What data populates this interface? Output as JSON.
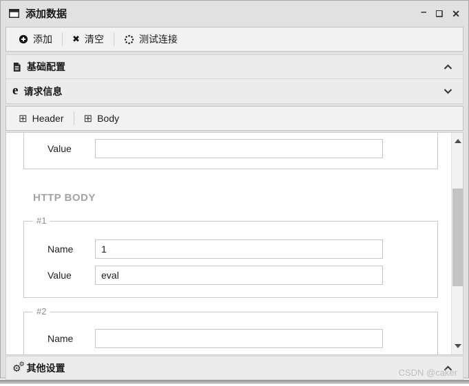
{
  "window": {
    "title": "添加数据"
  },
  "controls": {
    "minimize": "–",
    "maximize": "❑",
    "close": "✕"
  },
  "toolbar": {
    "add_label": "添加",
    "clear_label": "清空",
    "test_label": "测试连接"
  },
  "sections": {
    "basic_label": "基础配置",
    "request_label": "请求信息",
    "other_label": "其他设置"
  },
  "request_tabs": {
    "header_label": "Header",
    "body_label": "Body"
  },
  "content": {
    "top_group": {
      "value_label": "Value",
      "value_value": ""
    },
    "http_body_title": "HTTP BODY",
    "group1": {
      "legend": "#1",
      "name_label": "Name",
      "name_value": "1",
      "value_label": "Value",
      "value_value": "eval"
    },
    "group2": {
      "legend": "#2",
      "name_label": "Name",
      "name_value": ""
    }
  },
  "icons": {
    "clear_x": "✖",
    "plus_square": "⊞",
    "gear": "⚙",
    "request_e": "e"
  },
  "watermark": "CSDN @caker",
  "colors": {
    "window_bg": "#e1e1e1",
    "panel_bg": "#f2f2f2",
    "section_bg": "#ececec",
    "content_bg": "#ffffff",
    "border": "#c6c6c6",
    "text": "#1c1c1c",
    "muted_heading": "#a3a3a3",
    "scroll_thumb": "#c3c3c3",
    "watermark": "#c3bcbc"
  }
}
